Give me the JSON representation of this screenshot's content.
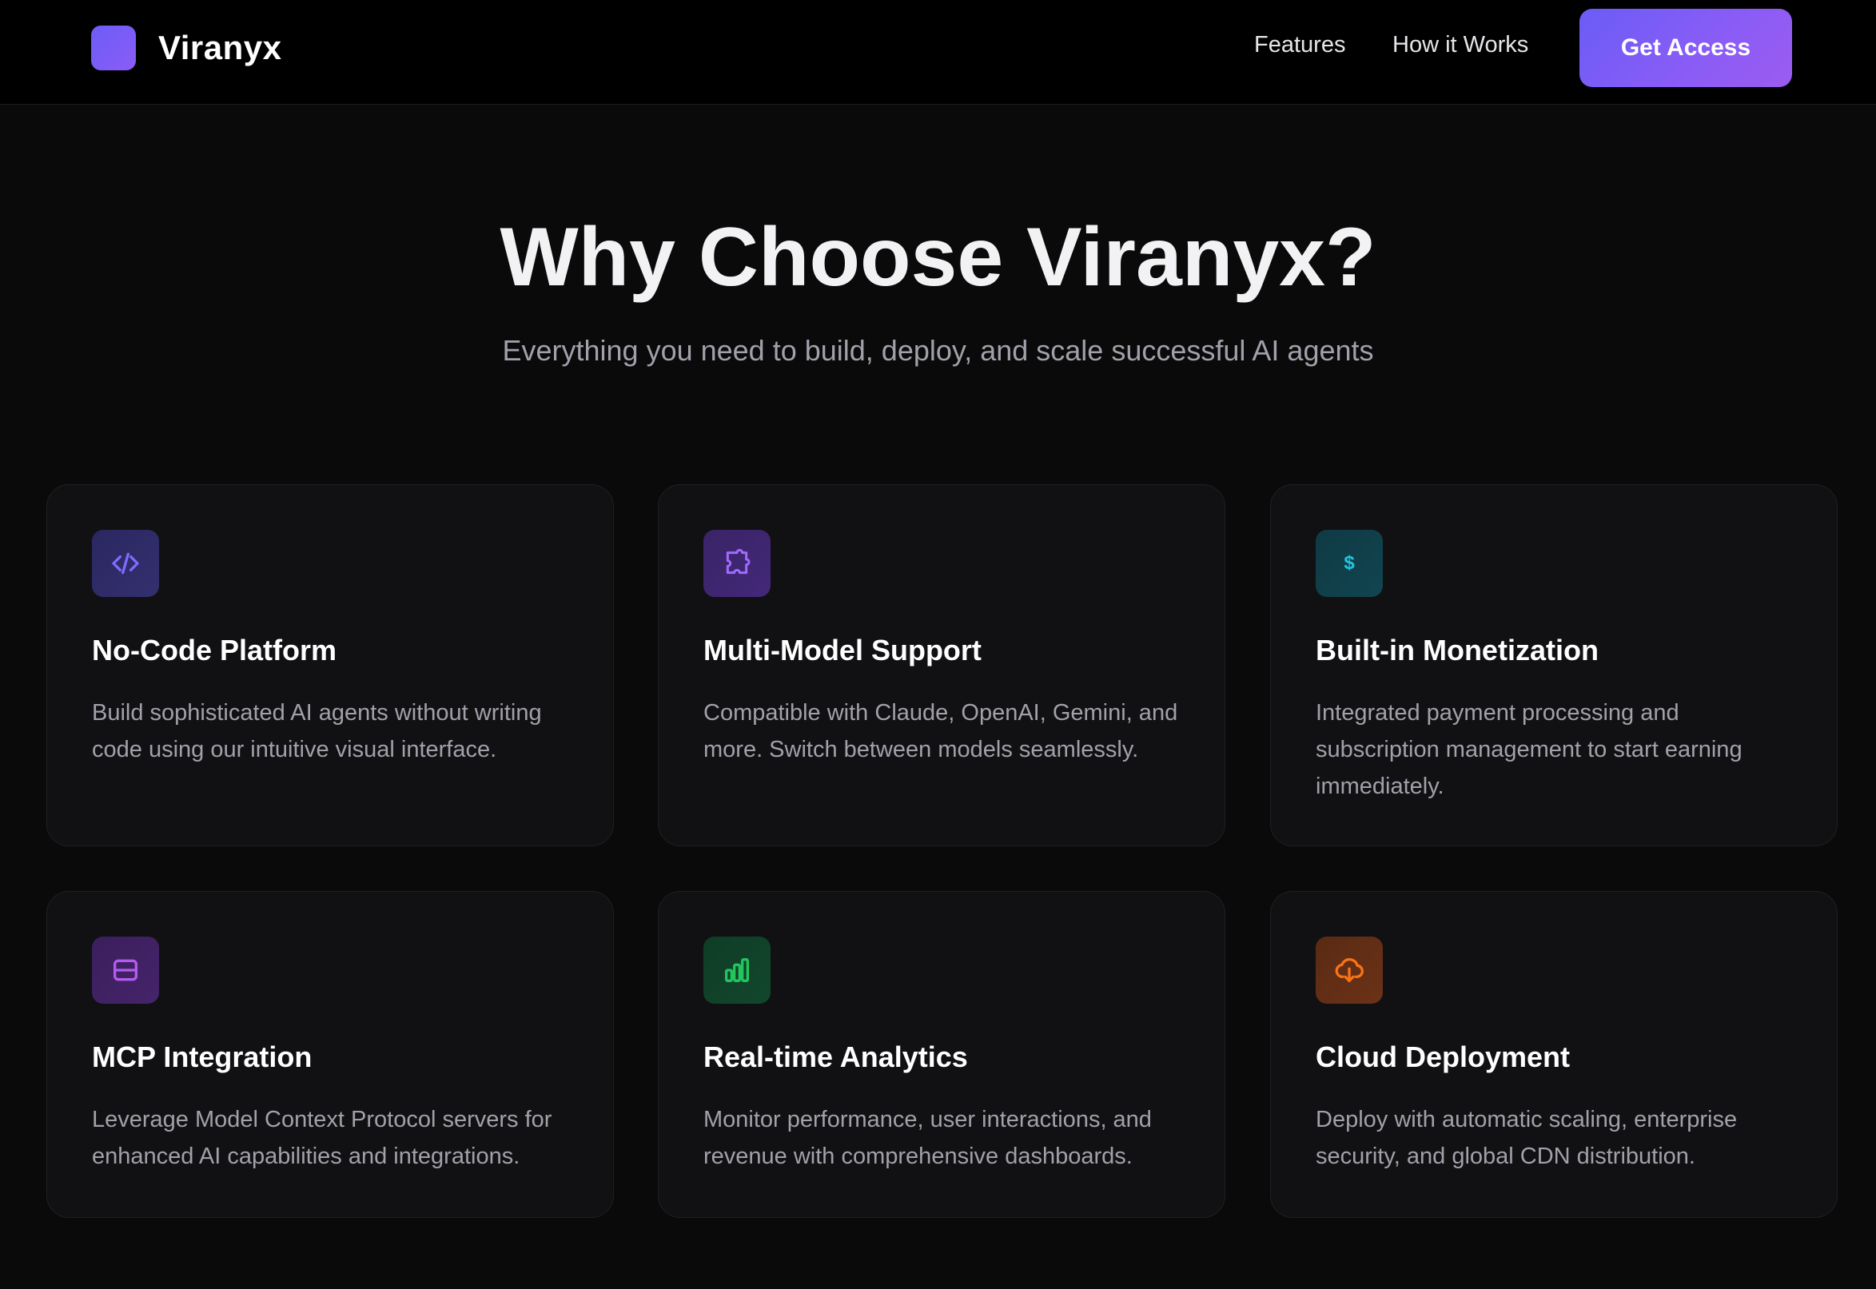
{
  "header": {
    "brand_name": "Viranyx",
    "nav": [
      {
        "label": "Features"
      },
      {
        "label": "How it Works"
      }
    ],
    "cta_label": "Get Access"
  },
  "hero": {
    "title": "Why Choose Viranyx?",
    "subtitle": "Everything you need to build, deploy, and scale successful AI agents"
  },
  "features": [
    {
      "title": "No-Code Platform",
      "description": "Build sophisticated AI agents without writing code using our intuitive visual interface.",
      "icon": "code-icon",
      "accent": "#7b6cff"
    },
    {
      "title": "Multi-Model Support",
      "description": "Compatible with Claude, OpenAI, Gemini, and more. Switch between models seamlessly.",
      "icon": "puzzle-icon",
      "accent": "#a06bff"
    },
    {
      "title": "Built-in Monetization",
      "description": "Integrated payment processing and subscription management to start earning immediately.",
      "icon": "dollar-icon",
      "icon_text": "$",
      "accent": "#22c5de"
    },
    {
      "title": "MCP Integration",
      "description": "Leverage Model Context Protocol servers for enhanced AI capabilities and integrations.",
      "icon": "server-icon",
      "accent": "#b45cf0"
    },
    {
      "title": "Real-time Analytics",
      "description": "Monitor performance, user interactions, and revenue with comprehensive dashboards.",
      "icon": "bar-chart-icon",
      "accent": "#22c55e"
    },
    {
      "title": "Cloud Deployment",
      "description": "Deploy with automatic scaling, enterprise security, and global CDN distribution.",
      "icon": "cloud-download-icon",
      "accent": "#f97316"
    }
  ]
}
